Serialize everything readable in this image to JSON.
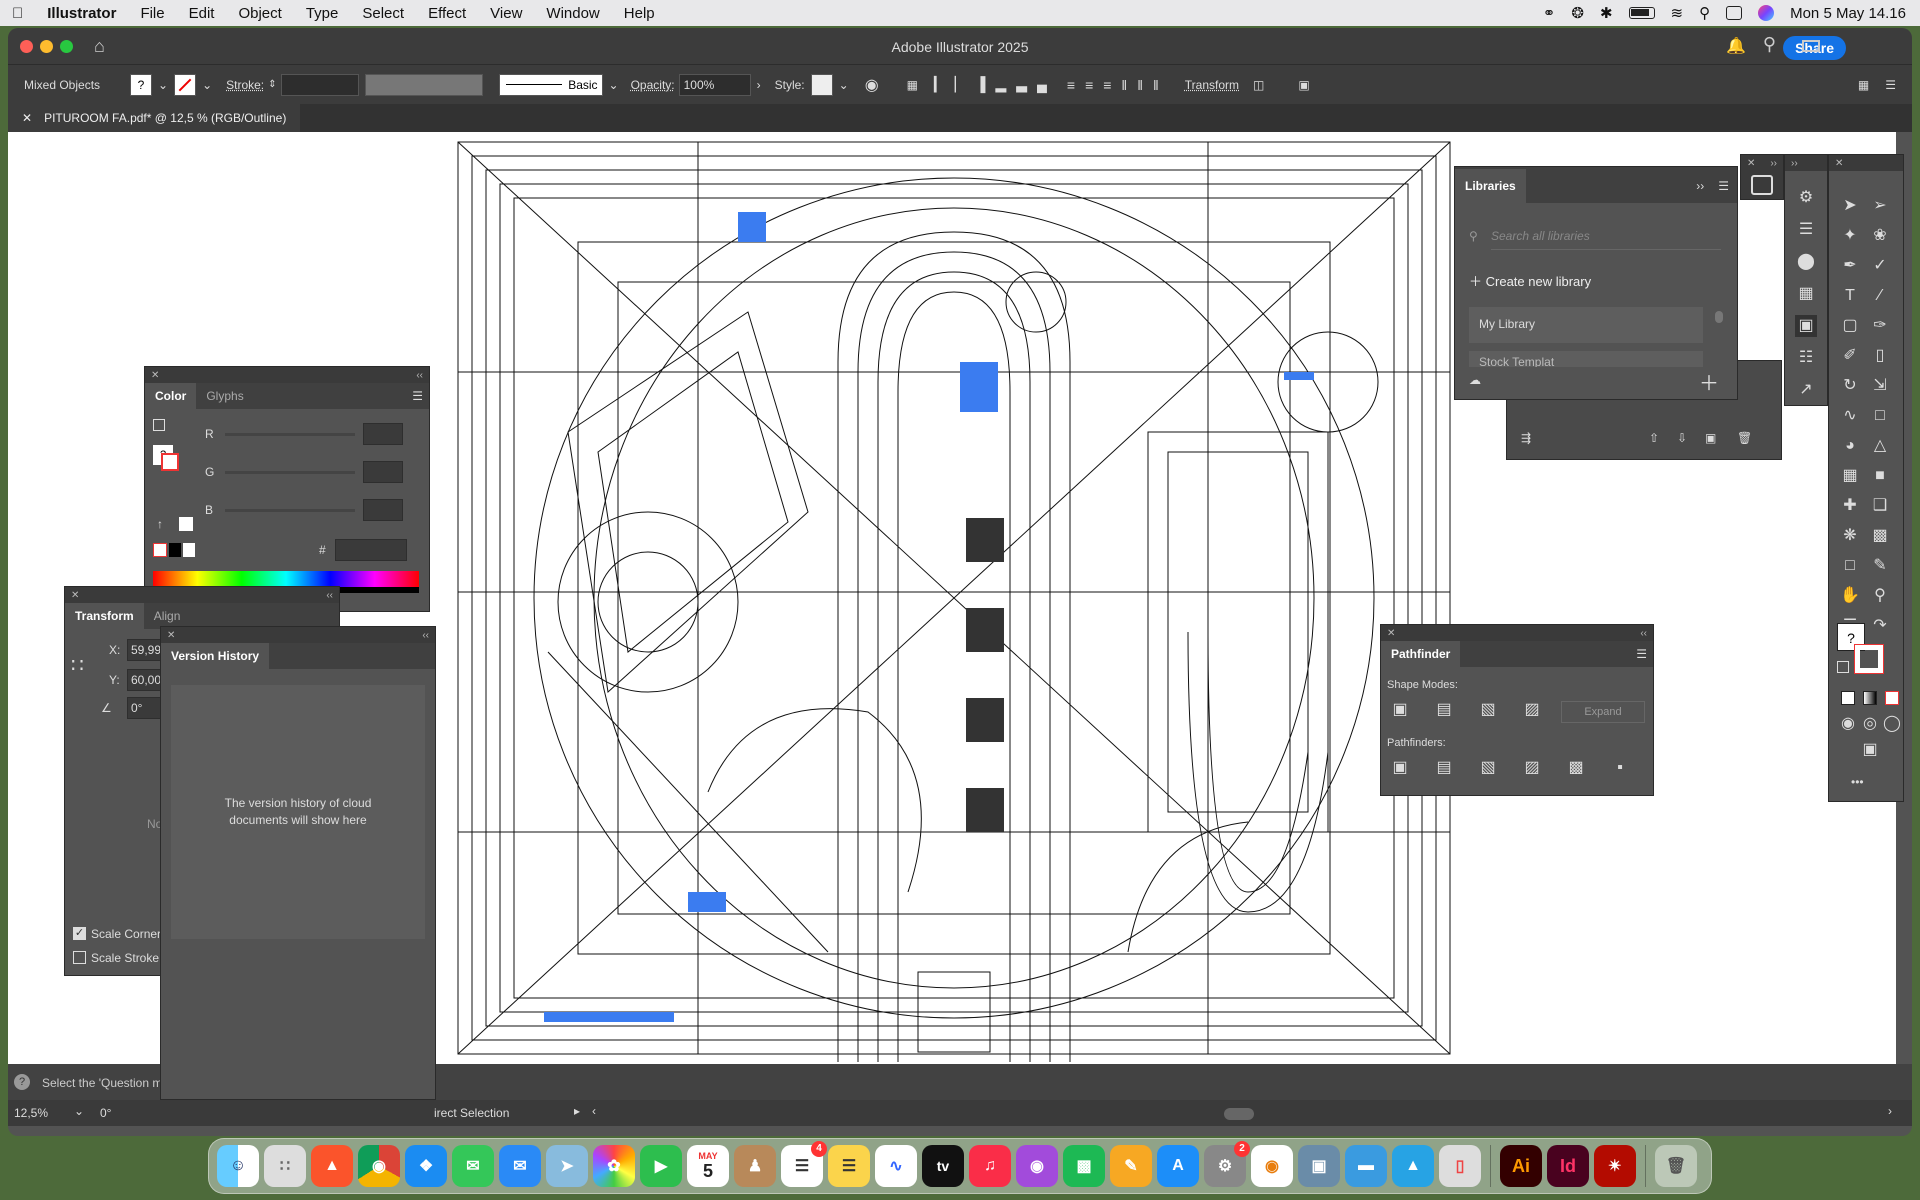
{
  "menubar": {
    "app": "Illustrator",
    "items": [
      "File",
      "Edit",
      "Object",
      "Type",
      "Select",
      "Effect",
      "View",
      "Window",
      "Help"
    ],
    "clock": "Mon 5 May  14.16"
  },
  "window": {
    "title": "Adobe Illustrator 2025",
    "share_label": "Share"
  },
  "controlbar": {
    "selection": "Mixed Objects",
    "stroke_label": "Stroke:",
    "brush_label": "Basic",
    "opacity_label": "Opacity:",
    "opacity_value": "100%",
    "style_label": "Style:",
    "transform_label": "Transform",
    "question": "?"
  },
  "document_tab": {
    "name": "PITUROOM FA.pdf* @ 12,5 % (RGB/Outline)"
  },
  "color_panel": {
    "tabs": [
      "Color",
      "Glyphs"
    ],
    "r": "R",
    "g": "G",
    "b": "B",
    "hash": "#",
    "question": "?"
  },
  "transform_panel": {
    "tabs": [
      "Transform",
      "Align"
    ],
    "x_label": "X:",
    "x_value": "59,99",
    "y_label": "Y:",
    "y_value": "60,00",
    "angle_value": "0°",
    "scale_corners": "Scale Corner",
    "scale_strokes": "Scale Stroke",
    "no_text": "No"
  },
  "version_history": {
    "title": "Version History",
    "message": "The version history of cloud documents will show here"
  },
  "libraries": {
    "title": "Libraries",
    "search_placeholder": "Search all libraries",
    "create_label": "Create new library",
    "my_library": "My Library",
    "stock_label": "Stock Templat"
  },
  "pathfinder": {
    "title": "Pathfinder",
    "shape_modes": "Shape Modes:",
    "expand": "Expand",
    "pathfinders": "Pathfinders:"
  },
  "status": {
    "hint": "Select the 'Question m",
    "zoom": "12,5%",
    "rotation": "0°",
    "tool": "irect Selection"
  },
  "toolbar": {
    "question": "?",
    "more": "•••"
  },
  "dock": {
    "calendar_month": "MAY",
    "calendar_day": "5",
    "reminders_badge": "4",
    "settings_badge": "2",
    "ai_label": "Ai",
    "id_label": "Id",
    "tv_label": "tv"
  },
  "colors": {
    "accent": "#1473e6",
    "selection": "#3b7cf0",
    "panel": "#535353"
  }
}
